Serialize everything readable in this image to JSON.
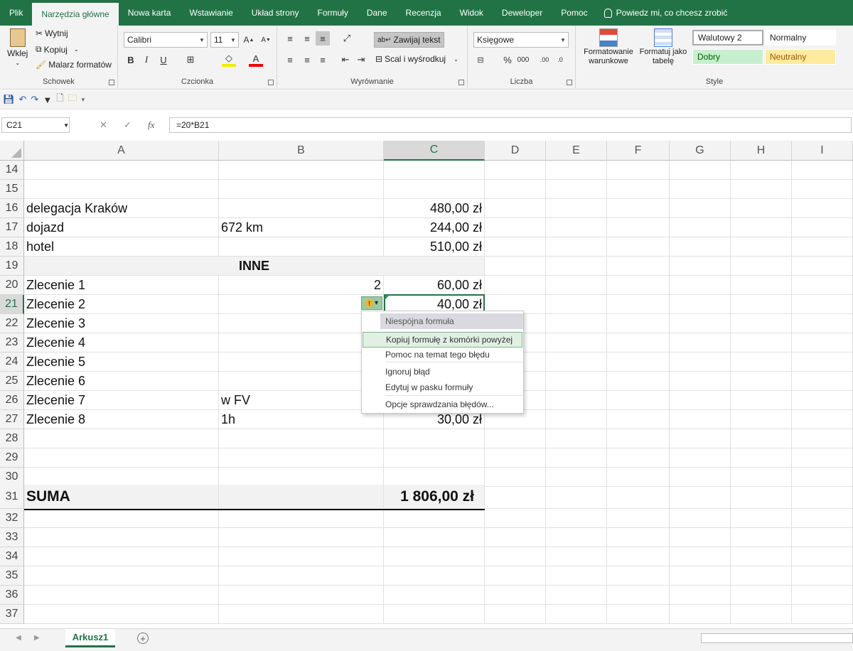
{
  "tabs": [
    "Plik",
    "Narzędzia główne",
    "Nowa karta",
    "Wstawianie",
    "Układ strony",
    "Formuły",
    "Dane",
    "Recenzja",
    "Widok",
    "Deweloper",
    "Pomoc"
  ],
  "tellme": "Powiedz mi, co chcesz zrobić",
  "ribbon": {
    "paste": "Wklej",
    "cut": "Wytnij",
    "copy": "Kopiuj",
    "painter": "Malarz formatów",
    "clipboard": "Schowek",
    "font_name": "Calibri",
    "font_size": "11",
    "font_group": "Czcionka",
    "wrap": "Zawijaj tekst",
    "merge": "Scal i wyśrodkuj",
    "align_group": "Wyrównanie",
    "number_format": "Księgowe",
    "number_group": "Liczba",
    "cond_format_1": "Formatowanie",
    "cond_format_2": "warunkowe",
    "fmt_table_1": "Formatuj jako",
    "fmt_table_2": "tabelę",
    "styles": [
      "Walutowy 2",
      "Normalny",
      "Dobry",
      "Neutralny"
    ],
    "styles_group": "Style"
  },
  "formula_bar": {
    "name_box": "C21",
    "formula": "=20*B21",
    "fx": "fx"
  },
  "columns": [
    "A",
    "B",
    "C",
    "D",
    "E",
    "F",
    "G",
    "H",
    "I"
  ],
  "rows": [
    {
      "n": "14",
      "a": "",
      "b": "",
      "c": ""
    },
    {
      "n": "15",
      "a": "",
      "b": "",
      "c": ""
    },
    {
      "n": "16",
      "a": "delegacja Kraków",
      "b": "",
      "c": "480,00 zł"
    },
    {
      "n": "17",
      "a": "dojazd",
      "b": "672 km",
      "c": "244,00 zł"
    },
    {
      "n": "18",
      "a": "hotel",
      "b": "",
      "c": "510,00 zł"
    },
    {
      "n": "19",
      "section": "INNE"
    },
    {
      "n": "20",
      "a": "Zlecenie 1",
      "b": "2",
      "c": "60,00 zł"
    },
    {
      "n": "21",
      "a": "Zlecenie 2",
      "b": "",
      "c": "40,00 zł"
    },
    {
      "n": "22",
      "a": "Zlecenie 3",
      "b": "",
      "c": ""
    },
    {
      "n": "23",
      "a": "Zlecenie 4",
      "b": "",
      "c": ""
    },
    {
      "n": "24",
      "a": "Zlecenie 5",
      "b": "",
      "c": ""
    },
    {
      "n": "25",
      "a": "Zlecenie 6",
      "b": "",
      "c": ""
    },
    {
      "n": "26",
      "a": "Zlecenie 7",
      "b": "w FV",
      "c": ""
    },
    {
      "n": "27",
      "a": "Zlecenie 8",
      "b": "1h",
      "c": "30,00 zł"
    },
    {
      "n": "28",
      "a": "",
      "b": "",
      "c": ""
    },
    {
      "n": "29",
      "a": "",
      "b": "",
      "c": ""
    },
    {
      "n": "30",
      "a": "",
      "b": "",
      "c": ""
    },
    {
      "n": "31",
      "a": "SUMA",
      "b": "",
      "c": "1 806,00 zł",
      "total": true
    },
    {
      "n": "32",
      "a": "",
      "b": "",
      "c": ""
    },
    {
      "n": "33",
      "a": "",
      "b": "",
      "c": ""
    },
    {
      "n": "34",
      "a": "",
      "b": "",
      "c": ""
    },
    {
      "n": "35",
      "a": "",
      "b": "",
      "c": ""
    },
    {
      "n": "36",
      "a": "",
      "b": "",
      "c": ""
    },
    {
      "n": "37",
      "a": "",
      "b": "",
      "c": ""
    }
  ],
  "error_menu": {
    "title": "Niespójna formuła",
    "items": [
      "Kopiuj formułę z komórki powyżej",
      "Pomoc na temat tego błędu",
      "Ignoruj błąd",
      "Edytuj w pasku formuły",
      "Opcje sprawdzania błędów..."
    ]
  },
  "sheet_tab": "Arkusz1",
  "colors": {
    "accent": "#217346",
    "highlight": "#e1efe4"
  }
}
